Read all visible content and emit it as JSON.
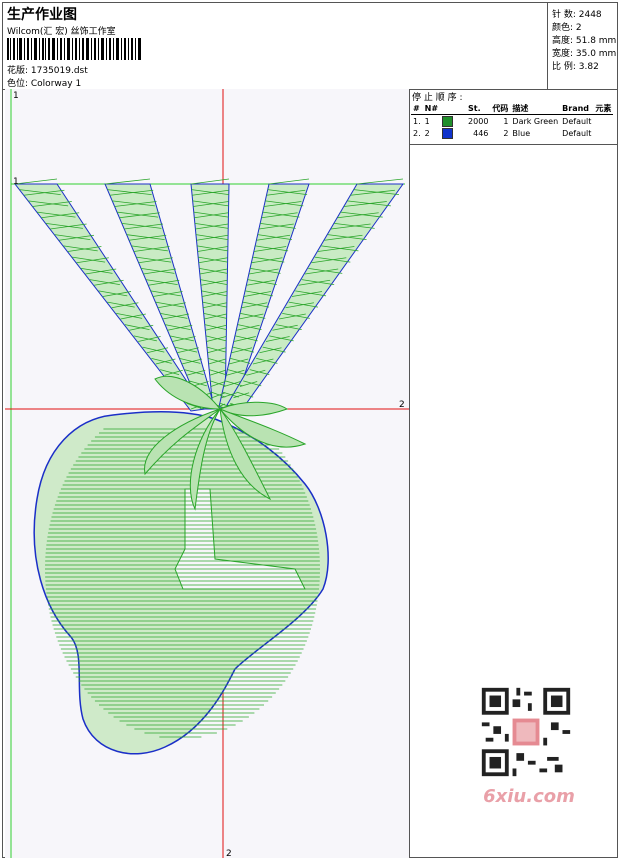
{
  "header": {
    "title": "生产作业图",
    "studio": "Wilcom(汇 宏) 丝饰工作室",
    "design_file": "花版: 1735019.dst",
    "colorway": "色位: Colorway 1"
  },
  "stats": {
    "stitches": "针 数: 2448",
    "colors": "颜色: 2",
    "height": "高度: 51.8 mm",
    "width": "宽度: 35.0 mm",
    "scale": "比 例: 3.82"
  },
  "stop_sequence": {
    "title": "停 止 顺 序 :",
    "columns": [
      "#",
      "N#",
      "St.",
      "代码",
      "描述",
      "Brand",
      "元素"
    ],
    "rows": [
      {
        "idx": "1.",
        "n": "1",
        "color": "#1f8f2a",
        "st": "2000",
        "code": "1",
        "desc": "Dark Green",
        "brand": "Default",
        "element": ""
      },
      {
        "idx": "2.",
        "n": "2",
        "color": "#1033cc",
        "st": "446",
        "code": "2",
        "desc": "Blue",
        "brand": "Default",
        "element": ""
      }
    ]
  },
  "guides": {
    "top_left": "1",
    "top_mark": "1",
    "right_mark": "2",
    "bottom_mark": "2"
  },
  "watermark": {
    "text": "6xiu.com"
  },
  "colors": {
    "thread_green": "#2aa52a",
    "thread_blue": "#1b2fc8",
    "guide_red": "#e01010",
    "guide_green": "#30d030"
  }
}
